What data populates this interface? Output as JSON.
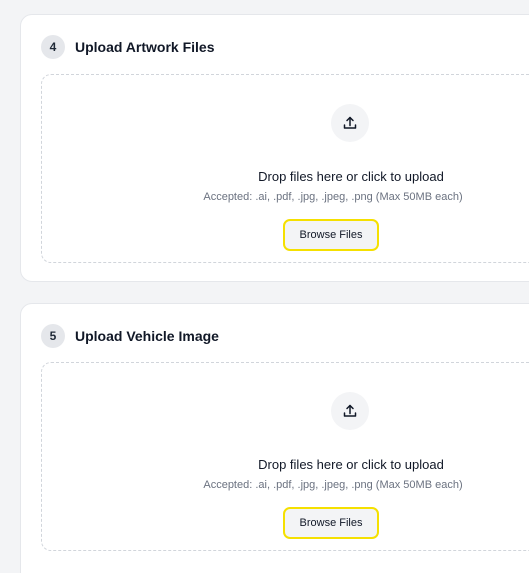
{
  "colors": {
    "background": "#f3f4f6",
    "card": "#ffffff",
    "badge": "#e5e7eb",
    "button_highlight": "#f5e000",
    "muted_text": "#6b7280"
  },
  "sections": [
    {
      "step": "4",
      "title": "Upload Artwork Files",
      "icon": "upload-icon",
      "drop_text": "Drop files here or click to upload",
      "accepted_text": "Accepted: .ai, .pdf, .jpg, .jpeg, .png (Max 50MB each)",
      "button_label": "Browse Files"
    },
    {
      "step": "5",
      "title": "Upload Vehicle Image",
      "icon": "upload-icon",
      "drop_text": "Drop files here or click to upload",
      "accepted_text": "Accepted: .ai, .pdf, .jpg, .jpeg, .png (Max 50MB each)",
      "button_label": "Browse Files"
    }
  ]
}
